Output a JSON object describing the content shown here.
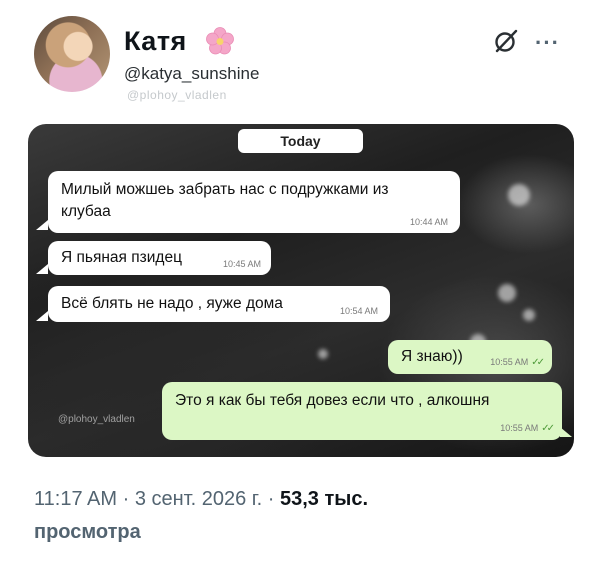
{
  "user": {
    "name": "Катя",
    "emoji": "🌸",
    "handle": "@katya_sunshine",
    "watermark": "@plohoy_vladlen"
  },
  "chat": {
    "date_label": "Today",
    "watermark": "@plohoy_vladlen",
    "messages": [
      {
        "dir": "in",
        "text_line1": "Милый можшеь забрать нас с подружками из",
        "text_line2": "клубаа",
        "time": "10:44 AM"
      },
      {
        "dir": "in",
        "text": "Я пьяная пзидец",
        "time": "10:45 AM"
      },
      {
        "dir": "in",
        "text": "Всё блять не надо , яуже дома",
        "time": "10:54 AM"
      },
      {
        "dir": "out",
        "text": "Я знаю))",
        "time": "10:55 AM"
      },
      {
        "dir": "out",
        "text": "Это я как бы тебя довез если что , алкошня",
        "time": "10:55 AM"
      }
    ]
  },
  "footer": {
    "time": "11:17 AM",
    "sep1": " · ",
    "date": "3 сент. 2026 г.",
    "sep2": " · ",
    "views_count": "53,3 тыс.",
    "views_word": "просмотра"
  },
  "colors": {
    "incoming_bubble": "#ffffff",
    "outgoing_bubble": "#dcf7c5",
    "muted_text": "#536471"
  }
}
